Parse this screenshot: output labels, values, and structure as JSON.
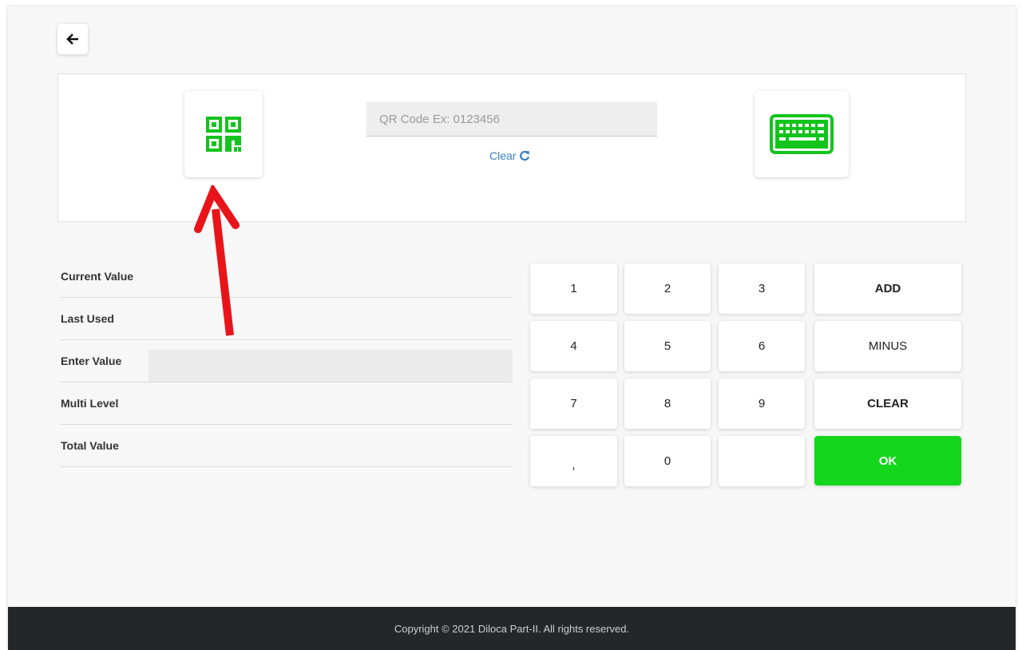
{
  "header": {
    "back_icon": "arrow-left-icon"
  },
  "scan": {
    "qr_icon": "qr-code-icon",
    "qr_placeholder": "QR Code Ex: 0123456",
    "qr_value": "",
    "clear_label": "Clear",
    "clear_icon": "refresh-icon",
    "keyboard_icon": "keyboard-icon",
    "accent_color": "#13c41d"
  },
  "fields": [
    {
      "label": "Current Value"
    },
    {
      "label": "Last Used"
    },
    {
      "label": "Enter Value",
      "input_value": ""
    },
    {
      "label": "Multi Level"
    },
    {
      "label": "Total Value"
    }
  ],
  "keypad": {
    "keys": [
      [
        "1",
        "2",
        "3",
        "ADD"
      ],
      [
        "4",
        "5",
        "6",
        "MINUS"
      ],
      [
        "7",
        "8",
        "9",
        "CLEAR"
      ],
      [
        ",",
        "0",
        "",
        "OK"
      ]
    ],
    "ok_color": "#13d61d"
  },
  "annotation": {
    "arrow_color": "#e8141a"
  },
  "footer": {
    "copyright": "Copyright © 2021 Diloca Part-II. All rights reserved."
  }
}
